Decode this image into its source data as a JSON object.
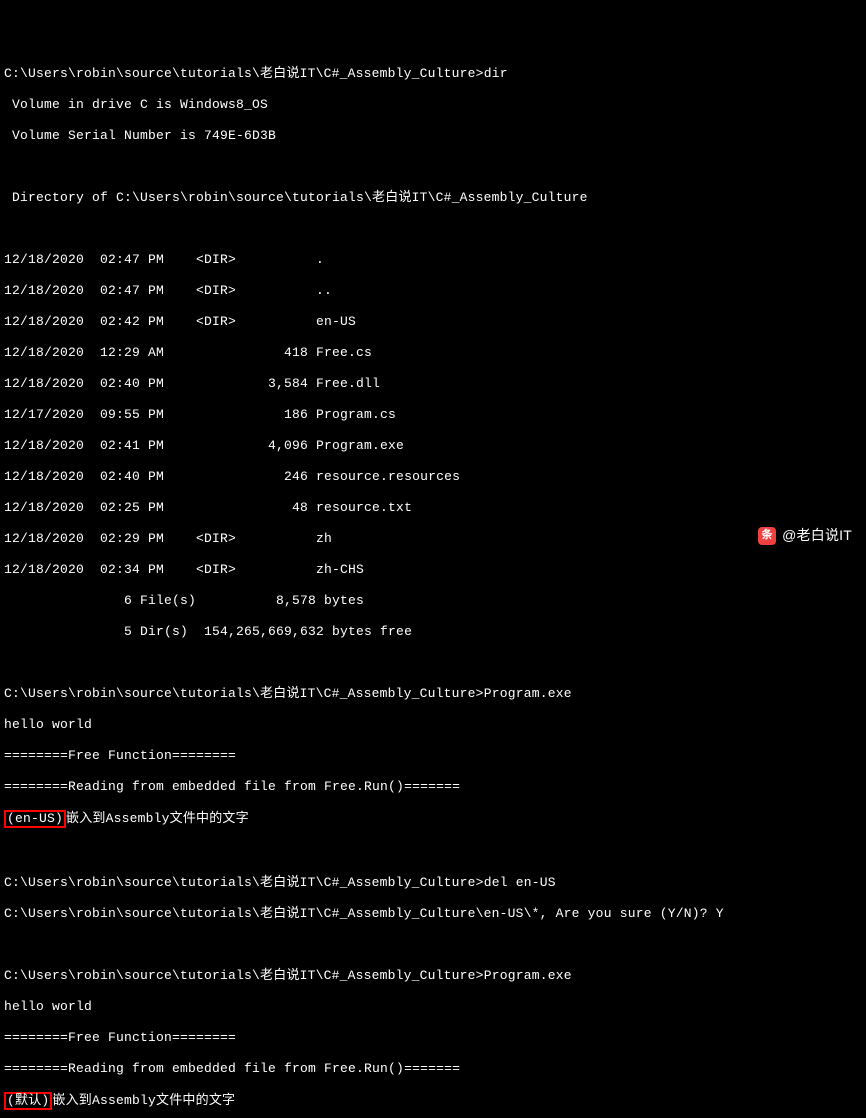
{
  "prompt_path": "C:\\Users\\robin\\source\\tutorials\\老白说IT\\C#_Assembly_Culture",
  "cmd_dir": "dir",
  "volume_line": " Volume in drive C is Windows8_OS",
  "serial_line": " Volume Serial Number is 749E-6D3B",
  "dir_of_line": " Directory of C:\\Users\\robin\\source\\tutorials\\老白说IT\\C#_Assembly_Culture",
  "entries": [
    "12/18/2020  02:47 PM    <DIR>          .",
    "12/18/2020  02:47 PM    <DIR>          ..",
    "12/18/2020  02:42 PM    <DIR>          en-US",
    "12/18/2020  12:29 AM               418 Free.cs",
    "12/18/2020  02:40 PM             3,584 Free.dll",
    "12/17/2020  09:55 PM               186 Program.cs",
    "12/18/2020  02:41 PM             4,096 Program.exe",
    "12/18/2020  02:40 PM               246 resource.resources",
    "12/18/2020  02:25 PM                48 resource.txt",
    "12/18/2020  02:29 PM    <DIR>          zh",
    "12/18/2020  02:34 PM    <DIR>          zh-CHS"
  ],
  "summary_files": "               6 File(s)          8,578 bytes",
  "summary_dirs": "               5 Dir(s)  154,265,669,632 bytes free",
  "cmd_run1": "Program.exe",
  "out_hello": "hello world",
  "out_free_header": "========Free Function========",
  "out_reading": "========Reading from embedded file from Free.Run()=======",
  "hl1": "(en-US)",
  "out_embed_suffix": "嵌入到Assembly文件中的文字",
  "cmd_del": "del en-US",
  "del_confirm": "C:\\Users\\robin\\source\\tutorials\\老白说IT\\C#_Assembly_Culture\\en-US\\*, Are you sure (Y/N)? Y",
  "cmd_run2": "Program.exe",
  "hl2": "(默认)",
  "watermark": "@老白说IT"
}
